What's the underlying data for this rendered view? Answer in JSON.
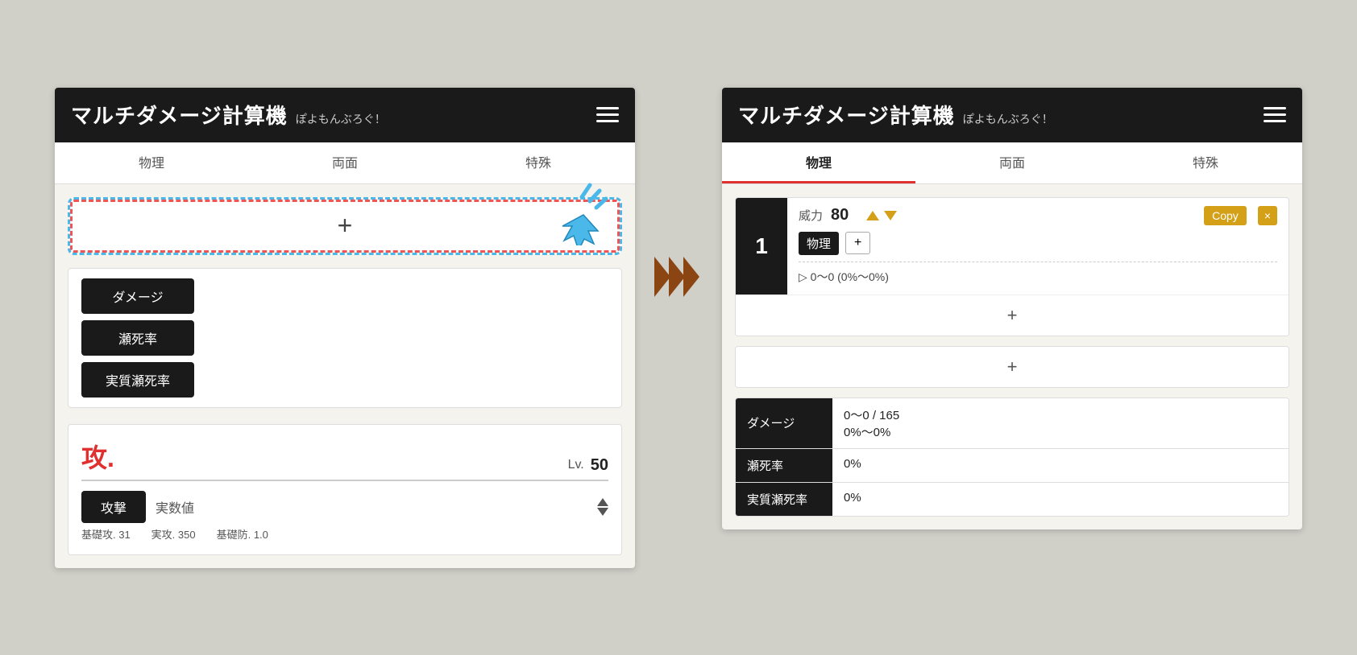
{
  "app": {
    "title": "マルチダメージ計算機",
    "subtitle": "ぽよもんぶろぐ！"
  },
  "tabs": [
    {
      "id": "butsuri",
      "label": "物理"
    },
    {
      "id": "ryomen",
      "label": "両面"
    },
    {
      "id": "toku",
      "label": "特殊"
    }
  ],
  "left_panel": {
    "add_placeholder": "+",
    "result_buttons": [
      "ダメージ",
      "瀬死率",
      "実質瀬死率"
    ],
    "attacker": {
      "label": "攻.",
      "lv_label": "Lv.",
      "lv_value": "50",
      "attack_btn": "攻撃",
      "attack_sub": "実数値",
      "bottom_text": "基礎攻. 31　　実攻. 350　　基礎防. 1.0"
    }
  },
  "arrow": "»»»",
  "right_panel": {
    "skill": {
      "number": "1",
      "power_label": "威力",
      "power_value": "80",
      "copy_label": "Copy",
      "x_label": "×",
      "type_tag": "物理",
      "add_btn": "+",
      "range_text": "▷ 0〜0 (0%〜0%)"
    },
    "add_label": "+",
    "results": [
      {
        "label": "ダメージ",
        "value": "0〜0 / 165\n0%〜0%"
      },
      {
        "label": "瀬死率",
        "value": "0%"
      },
      {
        "label": "実質瀬死率",
        "value": "0%"
      }
    ]
  }
}
